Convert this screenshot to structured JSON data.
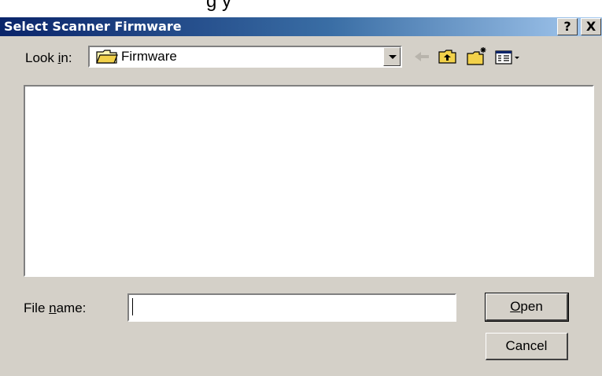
{
  "cropped_top_text": "g       y",
  "dialog": {
    "title": "Select Scanner Firmware",
    "help_button": "?",
    "close_button": "X"
  },
  "look_in": {
    "label_pre": "Look ",
    "label_mnemonic": "i",
    "label_post": "n:",
    "value": "Firmware",
    "icon": "folder-icon"
  },
  "toolbar": {
    "icons": [
      "back-arrow-icon",
      "up-one-level-icon",
      "new-folder-icon",
      "view-menu-icon"
    ]
  },
  "file_list": {
    "items": []
  },
  "file_name": {
    "label_pre": "File ",
    "label_mnemonic": "n",
    "label_post": "ame:",
    "value": ""
  },
  "buttons": {
    "open_mnemonic": "O",
    "open_rest": "pen",
    "cancel": "Cancel"
  },
  "colors": {
    "titlebar_start": "#0a246a",
    "titlebar_end": "#a6caf0",
    "face": "#d4d0c8"
  }
}
